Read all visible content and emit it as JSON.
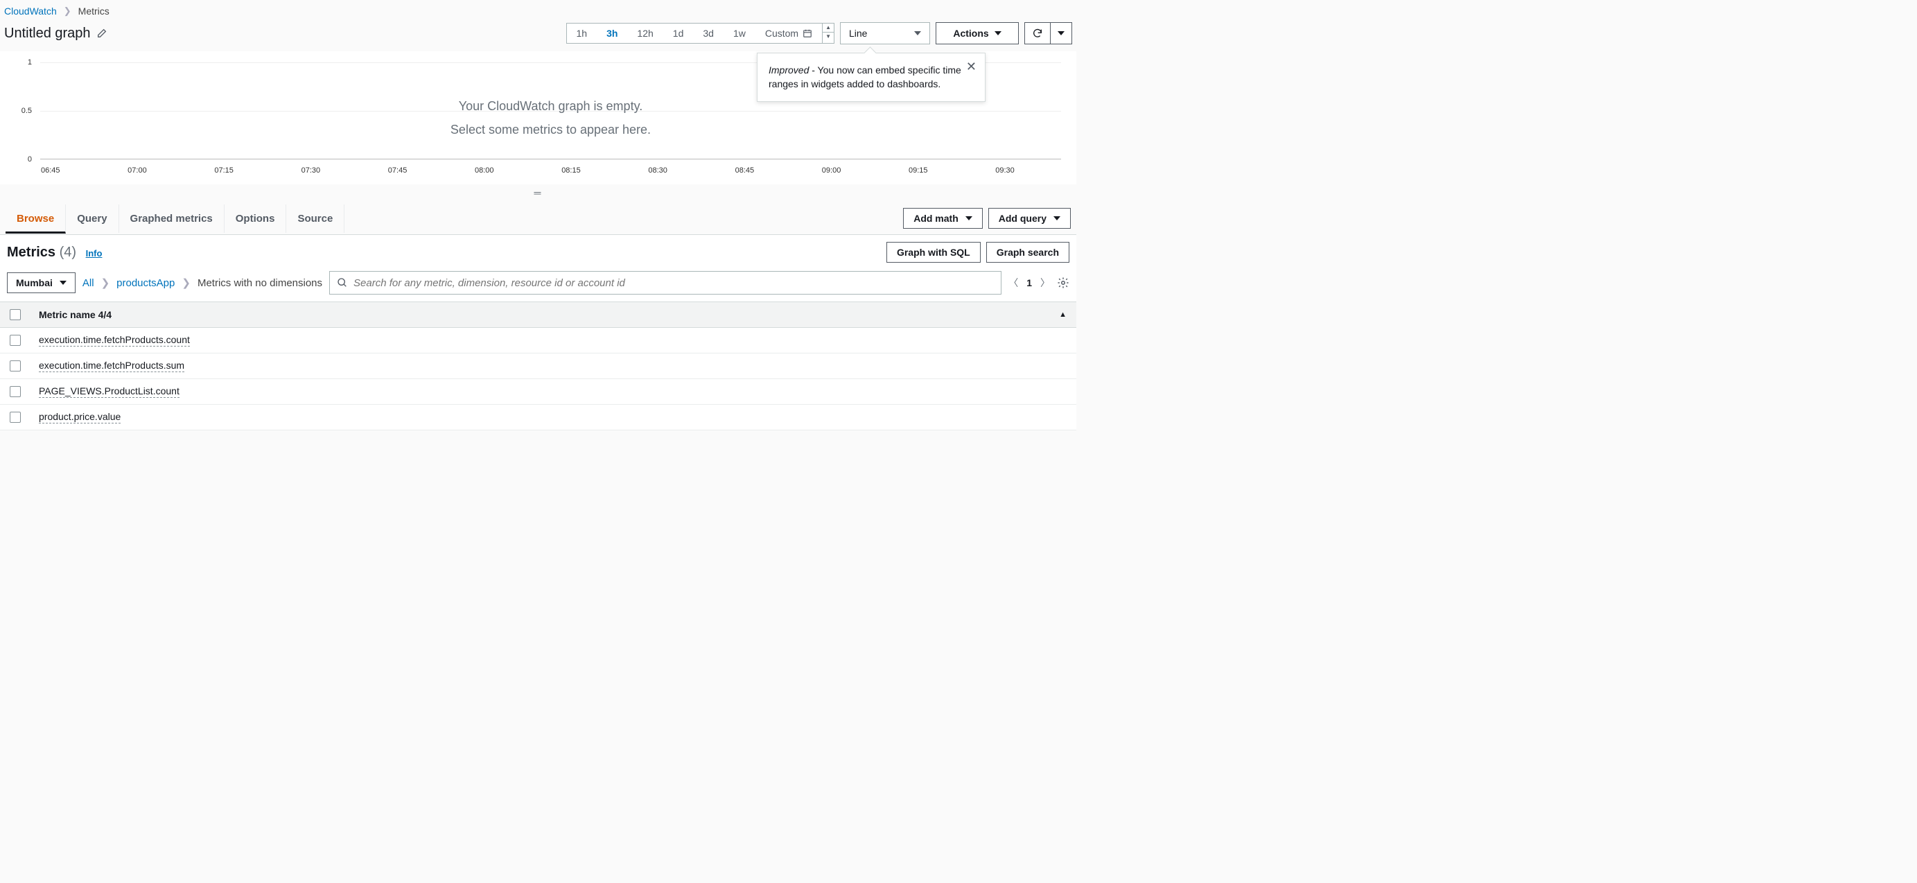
{
  "breadcrumb": {
    "root": "CloudWatch",
    "current": "Metrics"
  },
  "graph": {
    "title": "Untitled graph",
    "empty_line1": "Your CloudWatch graph is empty.",
    "empty_line2": "Select some metrics to appear here."
  },
  "time_range": {
    "options": [
      "1h",
      "3h",
      "12h",
      "1d",
      "3d",
      "1w"
    ],
    "active": "3h",
    "custom_label": "Custom"
  },
  "chart_type": {
    "value": "Line"
  },
  "actions_label": "Actions",
  "popover": {
    "prefix": "Improved",
    "text": " - You now can embed specific time ranges in widgets added to dashboards."
  },
  "chart_data": {
    "type": "line",
    "series": [],
    "ylim": [
      0,
      1
    ],
    "y_ticks": [
      0,
      0.5,
      1
    ],
    "x_ticks": [
      "06:45",
      "07:00",
      "07:15",
      "07:30",
      "07:45",
      "08:00",
      "08:15",
      "08:30",
      "08:45",
      "09:00",
      "09:15",
      "09:30"
    ]
  },
  "tabs": {
    "items": [
      "Browse",
      "Query",
      "Graphed metrics",
      "Options",
      "Source"
    ],
    "active": "Browse",
    "add_math": "Add math",
    "add_query": "Add query"
  },
  "metrics": {
    "heading": "Metrics",
    "count_text": "(4)",
    "info": "Info",
    "graph_sql": "Graph with SQL",
    "graph_search": "Graph search"
  },
  "filter": {
    "region": "Mumbai",
    "crumbs": {
      "all": "All",
      "namespace": "productsApp",
      "leaf": "Metrics with no dimensions"
    },
    "search_placeholder": "Search for any metric, dimension, resource id or account id",
    "page": "1"
  },
  "table": {
    "header": "Metric name 4/4",
    "rows": [
      "execution.time.fetchProducts.count",
      "execution.time.fetchProducts.sum",
      "PAGE_VIEWS.ProductList.count",
      "product.price.value"
    ]
  }
}
